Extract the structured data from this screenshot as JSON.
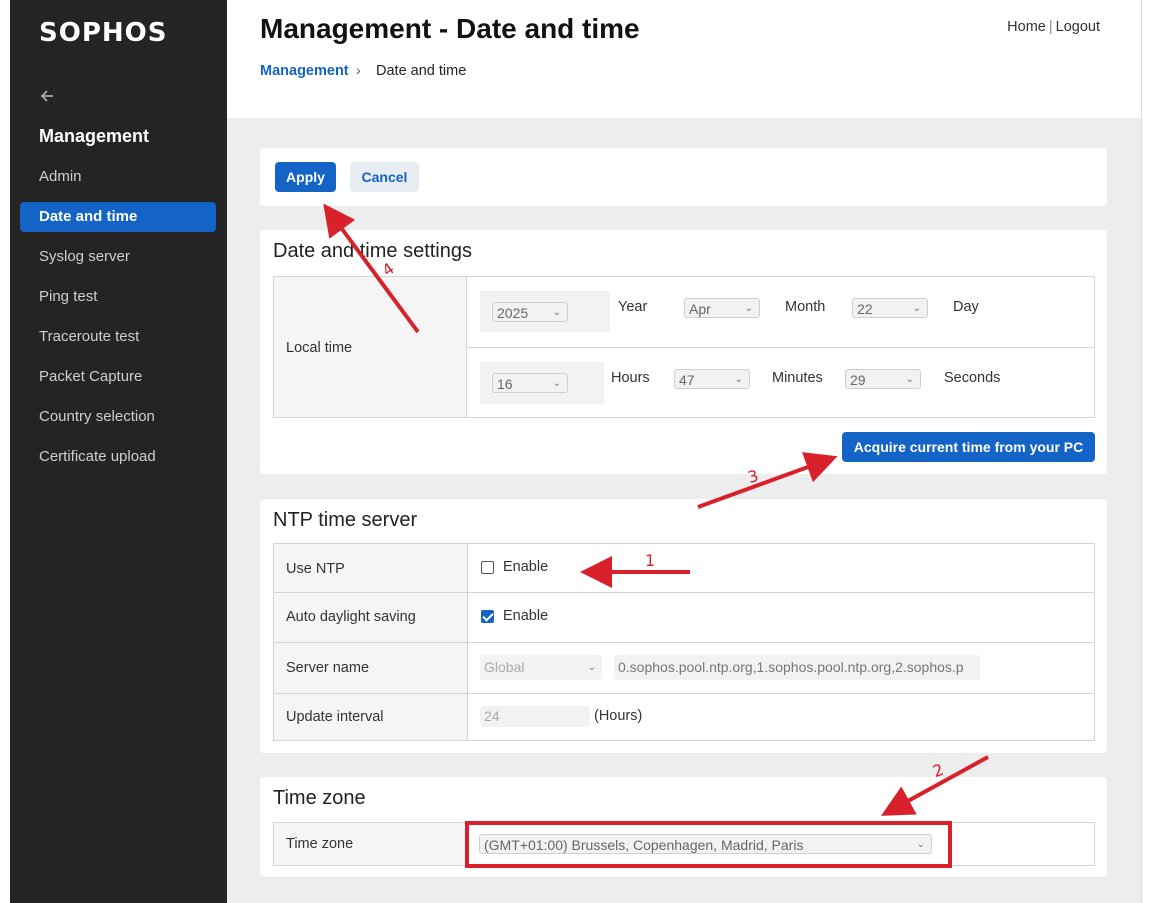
{
  "brand": "SOPHOS",
  "sidebar": {
    "title": "Management",
    "items": [
      {
        "label": "Admin"
      },
      {
        "label": "Date and time"
      },
      {
        "label": "Syslog server"
      },
      {
        "label": "Ping test"
      },
      {
        "label": "Traceroute test"
      },
      {
        "label": "Packet Capture"
      },
      {
        "label": "Country selection"
      },
      {
        "label": "Certificate upload"
      }
    ]
  },
  "header": {
    "title": "Management - Date and time",
    "breadcrumb": [
      "Management",
      "Date and time"
    ],
    "home": "Home",
    "separator": "|",
    "logout": "Logout"
  },
  "actions": {
    "apply": "Apply",
    "cancel": "Cancel"
  },
  "datetime": {
    "title": "Date and time settings",
    "local_time_label": "Local time",
    "year": "2025",
    "year_label": "Year",
    "month": "Apr",
    "month_label": "Month",
    "day": "22",
    "day_label": "Day",
    "hours": "16",
    "hours_label": "Hours",
    "minutes": "47",
    "minutes_label": "Minutes",
    "seconds": "29",
    "seconds_label": "Seconds",
    "acquire": "Acquire current time from your PC"
  },
  "ntp": {
    "title": "NTP time server",
    "use_ntp_label": "Use NTP",
    "use_ntp_enable": "Enable",
    "use_ntp_checked": false,
    "dst_label": "Auto daylight saving",
    "dst_enable": "Enable",
    "dst_checked": true,
    "server_label": "Server name",
    "server_region": "Global",
    "server_value": "0.sophos.pool.ntp.org,1.sophos.pool.ntp.org,2.sophos.p",
    "interval_label": "Update interval",
    "interval_value": "24",
    "interval_unit": "(Hours)"
  },
  "timezone": {
    "title": "Time zone",
    "label": "Time zone",
    "value": "(GMT+01:00) Brussels, Copenhagen, Madrid, Paris"
  },
  "annotations": {
    "n1": "1",
    "n2": "2",
    "n3": "3",
    "n4": "4",
    "color": "#d9212c"
  },
  "colors": {
    "accent": "#1463c7",
    "sidebar": "#242424",
    "background": "#ededed"
  }
}
